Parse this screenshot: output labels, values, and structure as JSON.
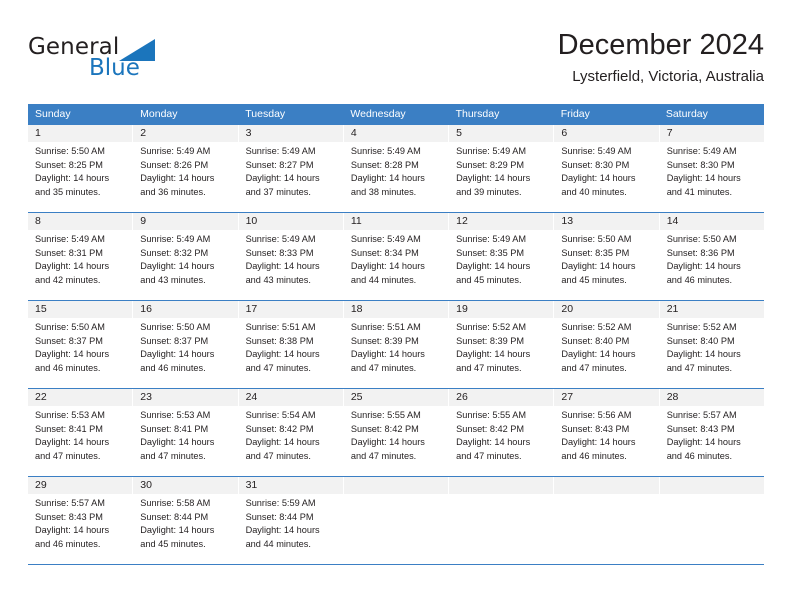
{
  "logo": {
    "word_one": "General",
    "word_two": "Blue",
    "accent_color": "#1b75bc"
  },
  "header": {
    "title": "December 2024",
    "location": "Lysterfield, Victoria, Australia"
  },
  "theme": {
    "header_blue": "#3b7fc4",
    "daynum_band": "#f2f2f2",
    "text": "#231f20"
  },
  "weekdays": [
    "Sunday",
    "Monday",
    "Tuesday",
    "Wednesday",
    "Thursday",
    "Friday",
    "Saturday"
  ],
  "weeks": [
    [
      {
        "day": "1",
        "sunrise": "Sunrise: 5:50 AM",
        "sunset": "Sunset: 8:25 PM",
        "daylight_line1": "Daylight: 14 hours",
        "daylight_line2": "and 35 minutes."
      },
      {
        "day": "2",
        "sunrise": "Sunrise: 5:49 AM",
        "sunset": "Sunset: 8:26 PM",
        "daylight_line1": "Daylight: 14 hours",
        "daylight_line2": "and 36 minutes."
      },
      {
        "day": "3",
        "sunrise": "Sunrise: 5:49 AM",
        "sunset": "Sunset: 8:27 PM",
        "daylight_line1": "Daylight: 14 hours",
        "daylight_line2": "and 37 minutes."
      },
      {
        "day": "4",
        "sunrise": "Sunrise: 5:49 AM",
        "sunset": "Sunset: 8:28 PM",
        "daylight_line1": "Daylight: 14 hours",
        "daylight_line2": "and 38 minutes."
      },
      {
        "day": "5",
        "sunrise": "Sunrise: 5:49 AM",
        "sunset": "Sunset: 8:29 PM",
        "daylight_line1": "Daylight: 14 hours",
        "daylight_line2": "and 39 minutes."
      },
      {
        "day": "6",
        "sunrise": "Sunrise: 5:49 AM",
        "sunset": "Sunset: 8:30 PM",
        "daylight_line1": "Daylight: 14 hours",
        "daylight_line2": "and 40 minutes."
      },
      {
        "day": "7",
        "sunrise": "Sunrise: 5:49 AM",
        "sunset": "Sunset: 8:30 PM",
        "daylight_line1": "Daylight: 14 hours",
        "daylight_line2": "and 41 minutes."
      }
    ],
    [
      {
        "day": "8",
        "sunrise": "Sunrise: 5:49 AM",
        "sunset": "Sunset: 8:31 PM",
        "daylight_line1": "Daylight: 14 hours",
        "daylight_line2": "and 42 minutes."
      },
      {
        "day": "9",
        "sunrise": "Sunrise: 5:49 AM",
        "sunset": "Sunset: 8:32 PM",
        "daylight_line1": "Daylight: 14 hours",
        "daylight_line2": "and 43 minutes."
      },
      {
        "day": "10",
        "sunrise": "Sunrise: 5:49 AM",
        "sunset": "Sunset: 8:33 PM",
        "daylight_line1": "Daylight: 14 hours",
        "daylight_line2": "and 43 minutes."
      },
      {
        "day": "11",
        "sunrise": "Sunrise: 5:49 AM",
        "sunset": "Sunset: 8:34 PM",
        "daylight_line1": "Daylight: 14 hours",
        "daylight_line2": "and 44 minutes."
      },
      {
        "day": "12",
        "sunrise": "Sunrise: 5:49 AM",
        "sunset": "Sunset: 8:35 PM",
        "daylight_line1": "Daylight: 14 hours",
        "daylight_line2": "and 45 minutes."
      },
      {
        "day": "13",
        "sunrise": "Sunrise: 5:50 AM",
        "sunset": "Sunset: 8:35 PM",
        "daylight_line1": "Daylight: 14 hours",
        "daylight_line2": "and 45 minutes."
      },
      {
        "day": "14",
        "sunrise": "Sunrise: 5:50 AM",
        "sunset": "Sunset: 8:36 PM",
        "daylight_line1": "Daylight: 14 hours",
        "daylight_line2": "and 46 minutes."
      }
    ],
    [
      {
        "day": "15",
        "sunrise": "Sunrise: 5:50 AM",
        "sunset": "Sunset: 8:37 PM",
        "daylight_line1": "Daylight: 14 hours",
        "daylight_line2": "and 46 minutes."
      },
      {
        "day": "16",
        "sunrise": "Sunrise: 5:50 AM",
        "sunset": "Sunset: 8:37 PM",
        "daylight_line1": "Daylight: 14 hours",
        "daylight_line2": "and 46 minutes."
      },
      {
        "day": "17",
        "sunrise": "Sunrise: 5:51 AM",
        "sunset": "Sunset: 8:38 PM",
        "daylight_line1": "Daylight: 14 hours",
        "daylight_line2": "and 47 minutes."
      },
      {
        "day": "18",
        "sunrise": "Sunrise: 5:51 AM",
        "sunset": "Sunset: 8:39 PM",
        "daylight_line1": "Daylight: 14 hours",
        "daylight_line2": "and 47 minutes."
      },
      {
        "day": "19",
        "sunrise": "Sunrise: 5:52 AM",
        "sunset": "Sunset: 8:39 PM",
        "daylight_line1": "Daylight: 14 hours",
        "daylight_line2": "and 47 minutes."
      },
      {
        "day": "20",
        "sunrise": "Sunrise: 5:52 AM",
        "sunset": "Sunset: 8:40 PM",
        "daylight_line1": "Daylight: 14 hours",
        "daylight_line2": "and 47 minutes."
      },
      {
        "day": "21",
        "sunrise": "Sunrise: 5:52 AM",
        "sunset": "Sunset: 8:40 PM",
        "daylight_line1": "Daylight: 14 hours",
        "daylight_line2": "and 47 minutes."
      }
    ],
    [
      {
        "day": "22",
        "sunrise": "Sunrise: 5:53 AM",
        "sunset": "Sunset: 8:41 PM",
        "daylight_line1": "Daylight: 14 hours",
        "daylight_line2": "and 47 minutes."
      },
      {
        "day": "23",
        "sunrise": "Sunrise: 5:53 AM",
        "sunset": "Sunset: 8:41 PM",
        "daylight_line1": "Daylight: 14 hours",
        "daylight_line2": "and 47 minutes."
      },
      {
        "day": "24",
        "sunrise": "Sunrise: 5:54 AM",
        "sunset": "Sunset: 8:42 PM",
        "daylight_line1": "Daylight: 14 hours",
        "daylight_line2": "and 47 minutes."
      },
      {
        "day": "25",
        "sunrise": "Sunrise: 5:55 AM",
        "sunset": "Sunset: 8:42 PM",
        "daylight_line1": "Daylight: 14 hours",
        "daylight_line2": "and 47 minutes."
      },
      {
        "day": "26",
        "sunrise": "Sunrise: 5:55 AM",
        "sunset": "Sunset: 8:42 PM",
        "daylight_line1": "Daylight: 14 hours",
        "daylight_line2": "and 47 minutes."
      },
      {
        "day": "27",
        "sunrise": "Sunrise: 5:56 AM",
        "sunset": "Sunset: 8:43 PM",
        "daylight_line1": "Daylight: 14 hours",
        "daylight_line2": "and 46 minutes."
      },
      {
        "day": "28",
        "sunrise": "Sunrise: 5:57 AM",
        "sunset": "Sunset: 8:43 PM",
        "daylight_line1": "Daylight: 14 hours",
        "daylight_line2": "and 46 minutes."
      }
    ],
    [
      {
        "day": "29",
        "sunrise": "Sunrise: 5:57 AM",
        "sunset": "Sunset: 8:43 PM",
        "daylight_line1": "Daylight: 14 hours",
        "daylight_line2": "and 46 minutes."
      },
      {
        "day": "30",
        "sunrise": "Sunrise: 5:58 AM",
        "sunset": "Sunset: 8:44 PM",
        "daylight_line1": "Daylight: 14 hours",
        "daylight_line2": "and 45 minutes."
      },
      {
        "day": "31",
        "sunrise": "Sunrise: 5:59 AM",
        "sunset": "Sunset: 8:44 PM",
        "daylight_line1": "Daylight: 14 hours",
        "daylight_line2": "and 44 minutes."
      },
      {
        "day": "",
        "sunrise": "",
        "sunset": "",
        "daylight_line1": "",
        "daylight_line2": ""
      },
      {
        "day": "",
        "sunrise": "",
        "sunset": "",
        "daylight_line1": "",
        "daylight_line2": ""
      },
      {
        "day": "",
        "sunrise": "",
        "sunset": "",
        "daylight_line1": "",
        "daylight_line2": ""
      },
      {
        "day": "",
        "sunrise": "",
        "sunset": "",
        "daylight_line1": "",
        "daylight_line2": ""
      }
    ]
  ]
}
